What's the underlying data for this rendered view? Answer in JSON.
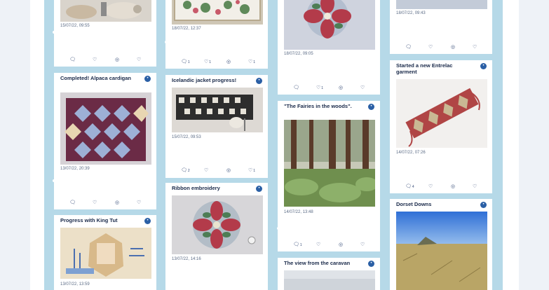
{
  "colors": {
    "board": "#b6d9e8",
    "card": "#ffffff",
    "title": "#1a2a4a",
    "badge": "#2a5fa5",
    "date": "#5b6b85"
  },
  "icons": {
    "comment": "comment-icon",
    "like": "heart-icon",
    "pin": "pin-icon",
    "view": "eye-icon"
  },
  "col1": {
    "card1": {
      "date": "15/07/22, 09:55"
    },
    "card2": {
      "title": "Completed! Alpaca cardigan",
      "date": "13/07/22, 20:39"
    },
    "card3": {
      "title": "Progress with King Tut",
      "date": "13/07/22, 13:59"
    }
  },
  "col2": {
    "card1": {
      "date": "18/07/22, 12:37",
      "comments": "1",
      "pins": "1",
      "likes": "1"
    },
    "card2": {
      "title": "Icelandic jacket progress!",
      "date": "15/07/22, 09:53",
      "comments": "2",
      "likes": "1"
    },
    "card3": {
      "title": "Ribbon embroidery",
      "date": "13/07/22, 14:16"
    }
  },
  "col3": {
    "card1": {
      "date": "18/07/22, 09:05",
      "pins": "1"
    },
    "card2": {
      "title": "\"The Fairies in the woods\".",
      "date": "14/07/22, 13:48",
      "comments": "1"
    },
    "card3": {
      "title": "The view from the caravan"
    }
  },
  "col4": {
    "card1": {
      "date": "18/07/22, 09:43"
    },
    "card2": {
      "title": "Started a new Entrelac garment",
      "date": "14/07/22, 07:26",
      "comments": "4"
    },
    "card3": {
      "title": "Dorset Downs"
    }
  }
}
